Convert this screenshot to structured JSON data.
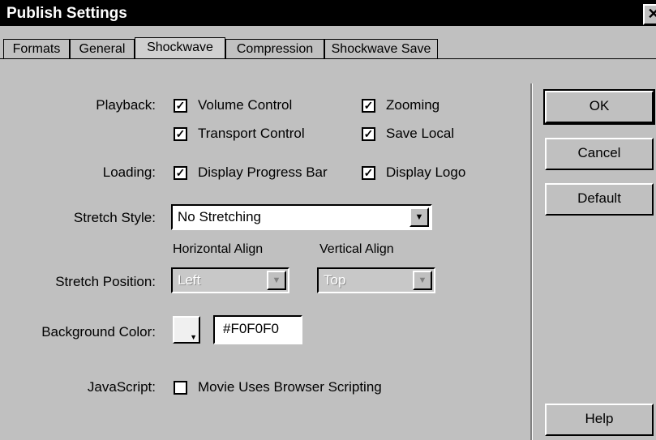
{
  "window": {
    "title": "Publish Settings",
    "close_glyph": "✕"
  },
  "tabs": [
    {
      "label": "Formats"
    },
    {
      "label": "General"
    },
    {
      "label": "Shockwave",
      "active": true
    },
    {
      "label": "Compression"
    },
    {
      "label": "Shockwave Save"
    }
  ],
  "playback": {
    "label": "Playback:",
    "volume_control": {
      "label": "Volume Control",
      "checked": true
    },
    "zooming": {
      "label": "Zooming",
      "checked": true
    },
    "transport_control": {
      "label": "Transport Control",
      "checked": true
    },
    "save_local": {
      "label": "Save Local",
      "checked": true
    }
  },
  "loading": {
    "label": "Loading:",
    "display_progress_bar": {
      "label": "Display Progress Bar",
      "checked": true
    },
    "display_logo": {
      "label": "Display Logo",
      "checked": true
    }
  },
  "stretch_style": {
    "label": "Stretch Style:",
    "value": "No Stretching"
  },
  "stretch_position": {
    "label": "Stretch Position:",
    "horizontal": {
      "label": "Horizontal Align",
      "value": "Left",
      "disabled": true
    },
    "vertical": {
      "label": "Vertical Align",
      "value": "Top",
      "disabled": true
    }
  },
  "background_color": {
    "label": "Background Color:",
    "value": "#F0F0F0",
    "swatch_color": "#f0f0f0"
  },
  "javascript": {
    "label": "JavaScript:",
    "movie_uses_browser_scripting": {
      "label": "Movie Uses Browser Scripting",
      "checked": false
    }
  },
  "buttons": {
    "ok": "OK",
    "cancel": "Cancel",
    "default": "Default",
    "help": "Help"
  },
  "check_glyph": "✓",
  "dropdown_glyph": "▼"
}
